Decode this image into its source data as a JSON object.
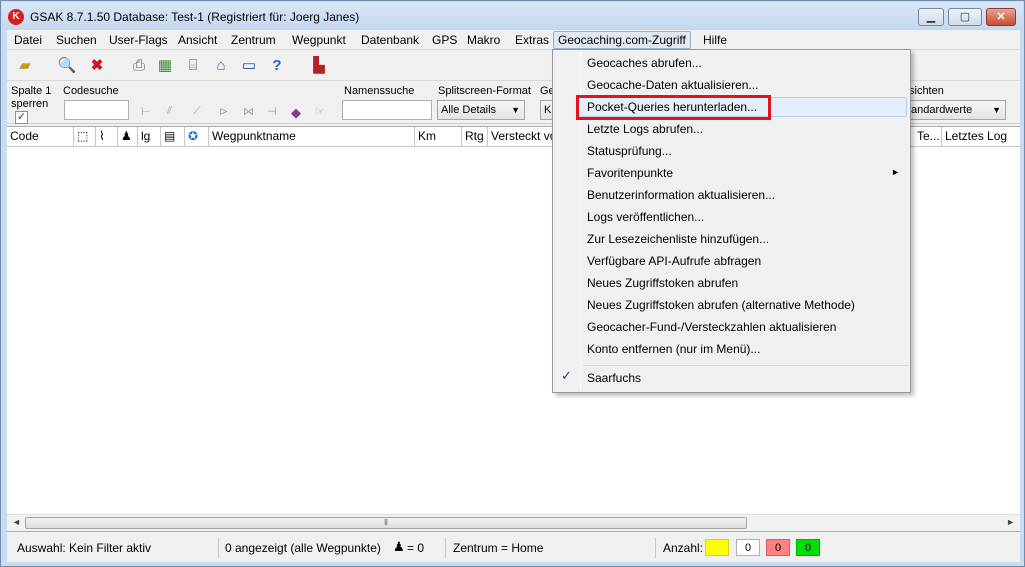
{
  "window": {
    "title": "GSAK 8.7.1.50    Database: Test-1    (Registriert für: Joerg Janes)",
    "icon": "gsak-logo-icon"
  },
  "menubar": [
    "Datei",
    "Suchen",
    "User-Flags",
    "Ansicht",
    "Zentrum",
    "Wegpunkt",
    "Datenbank",
    "GPS",
    "Makro",
    "Extras",
    "Geocaching.com-Zugriff",
    "Hilfe"
  ],
  "active_menu": "Geocaching.com-Zugriff",
  "toolbar": {
    "icons": [
      "open-folder-icon",
      "preview-icon",
      "delete-icon",
      "print-icon",
      "grid-icon",
      "tree-icon",
      "home-icon",
      "window-icon",
      "help-icon",
      "exit-icon"
    ]
  },
  "filterbar": {
    "lock_column_label_1": "Spalte 1",
    "lock_column_label_2": "sperren",
    "lock_column_checked": "✓",
    "code_search_label": "Codesuche",
    "name_search_label": "Namenssuche",
    "split_label": "Splitscreen-Format",
    "split_value": "Alle Details",
    "ge_label": "Ge",
    "ge_value": "K",
    "views_label": "sichten",
    "views_value": "tandardwerte"
  },
  "grid": {
    "columns": [
      "Code",
      "",
      "",
      "",
      "lg",
      "",
      "",
      "Wegpunktname",
      "Km",
      "Rtg",
      "Versteckt vo",
      "Te...",
      "Letztes Log"
    ]
  },
  "statusbar": {
    "filter": "Auswahl: Kein Filter aktiv",
    "shown": "0 angezeigt (alle Wegpunkte)",
    "person_count": "= 0",
    "center": "Zentrum = Home",
    "count_label": "Anzahl:",
    "counters": [
      {
        "value": "",
        "color": "#ffff00"
      },
      {
        "value": "0",
        "color": "#ffffff"
      },
      {
        "value": "0",
        "color": "#ff8080"
      },
      {
        "value": "0",
        "color": "#00e000"
      }
    ]
  },
  "dropdown": {
    "items": [
      "Geocaches abrufen...",
      "Geocache-Daten aktualisieren...",
      "Pocket-Queries herunterladen...",
      "Letzte Logs abrufen...",
      "Statusprüfung...",
      "Favoritenpunkte",
      "Benutzerinformation aktualisieren...",
      "Logs veröffentlichen...",
      "Zur Lesezeichenliste hinzufügen...",
      "Verfügbare API-Aufrufe abfragen",
      "Neues Zugriffstoken abrufen",
      "Neues Zugriffstoken abrufen (alternative Methode)",
      "Geocacher-Fund-/Versteckzahlen aktualisieren",
      "Konto entfernen (nur im Menü)..."
    ],
    "checked_item": "Saarfuchs",
    "highlighted_index": 2,
    "submenu_index": 5,
    "highlight_color": "#e0151b"
  }
}
